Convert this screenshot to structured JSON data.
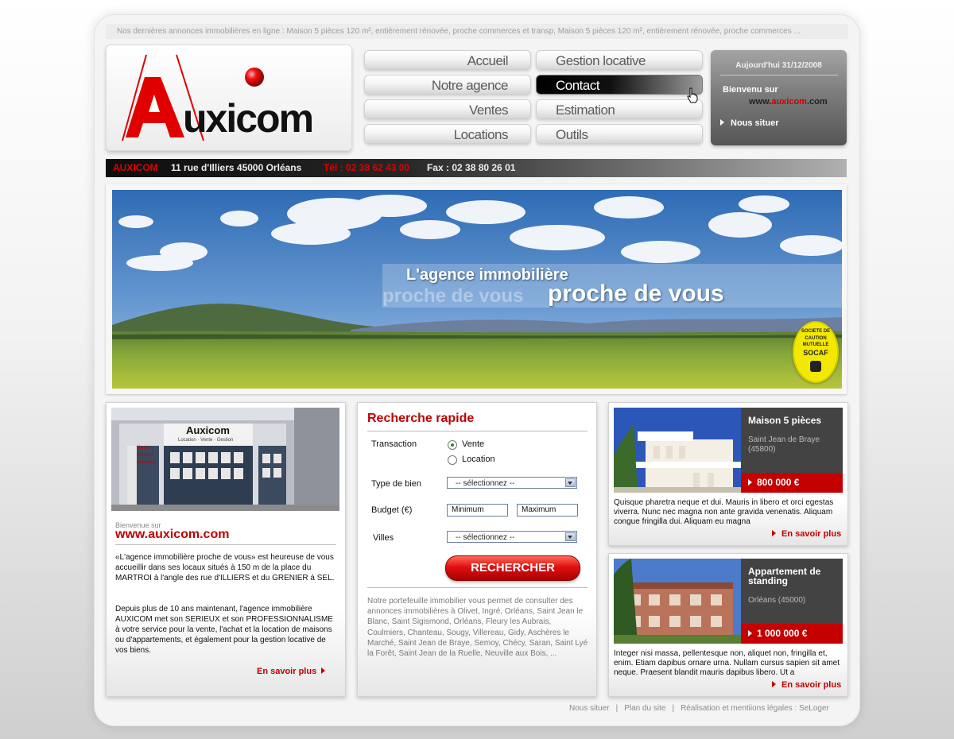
{
  "ticker": "Nos dernières annonces immobilières en ligne : Maison 5 pièces 120 m², entièrement rénovée, proche commerces et transp, Maison 5 pièces 120 m², entièrement rénovée, proche commerces ...",
  "logo": {
    "text": "AUXICOM"
  },
  "nav": {
    "left": [
      "Accueil",
      "Notre agence",
      "Ventes",
      "Locations"
    ],
    "right": [
      "Gestion locative",
      "Contact",
      "Estimation",
      "Outils"
    ],
    "active": "Contact"
  },
  "datebox": {
    "date": "Aujourd'hui 31/12/2008",
    "welcome": "Bienvenu sur",
    "site_prefix": "www.",
    "site_name": "auxicom",
    "site_suffix": ".com",
    "locate": "Nous situer"
  },
  "infobar": {
    "brand": "AUXICOM",
    "address": "11 rue d'Illiers 45000 Orléans",
    "tel": "Tél : 02 38 62 43 00",
    "fax": "Fax : 02 38 80 26 01"
  },
  "banner": {
    "line1": "L'agence immobilière",
    "line2": "proche de vous",
    "badge": [
      "SOCIETE DE",
      "CAUTION",
      "MUTUELLE",
      "SOCAF"
    ]
  },
  "about": {
    "bienvenue": "Bienvenue sur",
    "website": "www.auxicom.com",
    "shop_sign": "Auxicom",
    "shop_sub": "Location · Vente · Gestion",
    "shop_window": [
      "Vente",
      "Gestion",
      "Location"
    ],
    "para1": "«L'agence immobilière proche de vous» est heureuse de vous accueillir dans ses locaux situés à 150 m de la place du MARTROI à l'angle des rue d'ILLIERS et du GRENIER à SEL.",
    "para2": "Depuis plus de 10 ans maintenant, l'agence immobilière AUXICOM met son SERIEUX et son PROFESSIONNALISME à votre service pour la vente, l'achat et la location de maisons ou d'appartements, et également pour la gestion locative de vos biens.",
    "more": "En savoir plus"
  },
  "search": {
    "title": "Recherche rapide",
    "transaction_label": "Transaction",
    "options": [
      "Vente",
      "Location"
    ],
    "selected_option": "Vente",
    "type_label": "Type de bien",
    "type_value": "-- sélectionnez --",
    "budget_label": "Budget (€)",
    "min_placeholder": "Minimum",
    "max_placeholder": "Maximum",
    "villes_label": "Villes",
    "villes_value": "-- sélectionnez --",
    "button": "RECHERCHER",
    "cities_text": "Notre portefeuille immobilier vous permet de consulter des annonces immobilières à  Olivet,  Ingré,  Orléans,  Saint Jean le Blanc,  Saint Sigismond,  Orléans,  Fleury les Aubrais,  Coulmiers,  Chanteau,  Sougy,  Villereau,  Gidy,  Aschères le Marché,  Saint Jean de Braye,  Semoy,  Chécy,  Saran,  Saint Lyé la Forêt,  Saint Jean de la Ruelle,  Neuville aux Bois,  ..."
  },
  "properties": [
    {
      "name": "Maison 5 pièces",
      "location": "Saint Jean de Braye (45800)",
      "price": "800 000 €",
      "text": "Quisque pharetra neque et dui. Mauris in libero et orci egestas viverra. Nunc nec magna non ante gravida venenatis. Aliquam congue fringilla dui. Aliquam eu magna",
      "more": "En savoir plus"
    },
    {
      "name": "Appartement de standing",
      "location": "Orléans (45000)",
      "price": "1 000 000 €",
      "text": "Integer nisi massa, pellentesque non, aliquet non, fringilla et, enim. Etiam dapibus ornare urna. Nullam cursus sapien sit amet neque. Praesent blandit mauris dapibus libero. Ut a",
      "more": "En savoir plus"
    }
  ],
  "footer": [
    "Nous situer",
    "Plan du site",
    "Réalisation et mentiions légales : SeLoger"
  ],
  "colors": {
    "brand_red": "#c00000",
    "dark": "#434343"
  }
}
